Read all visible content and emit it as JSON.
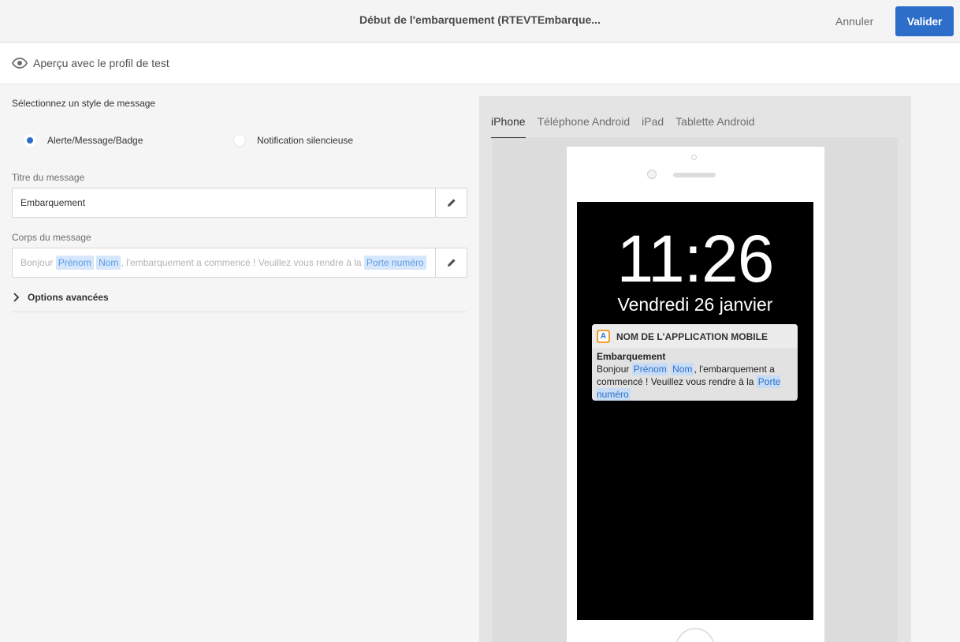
{
  "header": {
    "title": "Début de l'embarquement (RTEVTEmbarque...",
    "cancel_label": "Annuler",
    "validate_label": "Valider"
  },
  "preview_bar": {
    "label": "Aperçu avec le profil de test",
    "icon": "eye-icon"
  },
  "form": {
    "style_label": "Sélectionnez un style de message",
    "radio_options": [
      {
        "label": "Alerte/Message/Badge",
        "selected": true
      },
      {
        "label": "Notification silencieuse",
        "selected": false
      }
    ],
    "title_label": "Titre du message",
    "title_value": "Embarquement",
    "body_label": "Corps du message",
    "body": {
      "part1": "Bonjour",
      "token1": "Prénom",
      "token2": "Nom",
      "part2": ", l'embarquement a commencé ! Veuillez vous rendre à la",
      "token3": "Porte numéro"
    },
    "advanced_label": "Options avancées",
    "accent_color": "#2d6ec9"
  },
  "preview": {
    "tabs": [
      "iPhone",
      "Téléphone Android",
      "iPad",
      "Tablette Android"
    ],
    "active_tab": 0,
    "lock_screen": {
      "time": "11:26",
      "date": "Vendredi 26 janvier"
    },
    "notification": {
      "app_icon_letter": "A",
      "app_name": "NOM DE L'APPLICATION MOBILE",
      "title": "Embarquement",
      "body_start": "Bonjour",
      "token1": "Prénom",
      "token2": "Nom",
      "body_mid": ", l'embarquement a commencé ! Veuillez vous rendre à la",
      "token3": "Porte numéro"
    }
  }
}
